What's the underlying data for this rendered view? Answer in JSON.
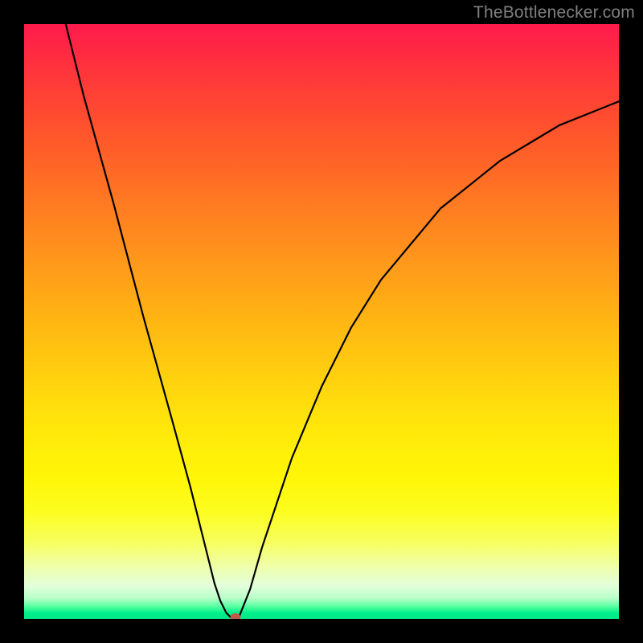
{
  "watermark": "TheBottlenecker.com",
  "colors": {
    "frame": "#000000",
    "watermark_text": "#7f7f7f",
    "curve_stroke": "#000000",
    "marker": "#c15a4a",
    "gradient_top": "#ff1a4d",
    "gradient_bottom": "#00e688"
  },
  "chart_data": {
    "type": "line",
    "title": "",
    "xlabel": "",
    "ylabel": "",
    "xlim": [
      0,
      100
    ],
    "ylim": [
      0,
      100
    ],
    "grid": false,
    "legend": false,
    "x": [
      7,
      10,
      15,
      20,
      25,
      28,
      30,
      31,
      32,
      33,
      34,
      35,
      36,
      38,
      40,
      45,
      50,
      55,
      60,
      65,
      70,
      75,
      80,
      85,
      90,
      95,
      100
    ],
    "values": [
      100,
      88,
      70,
      51,
      33,
      22,
      14,
      10,
      6,
      3,
      1,
      0,
      0,
      5,
      12,
      27,
      39,
      49,
      57,
      63,
      69,
      73,
      77,
      80,
      83,
      85,
      87
    ],
    "marker": {
      "x": 35.5,
      "y": 0
    },
    "notes": "Gradient background encodes bottleneck severity: red (top, high) → yellow (mid) → green (bottom, 0%). Black V-shaped curve dips to ~0 near x≈35, with an orange marker at the minimum."
  }
}
